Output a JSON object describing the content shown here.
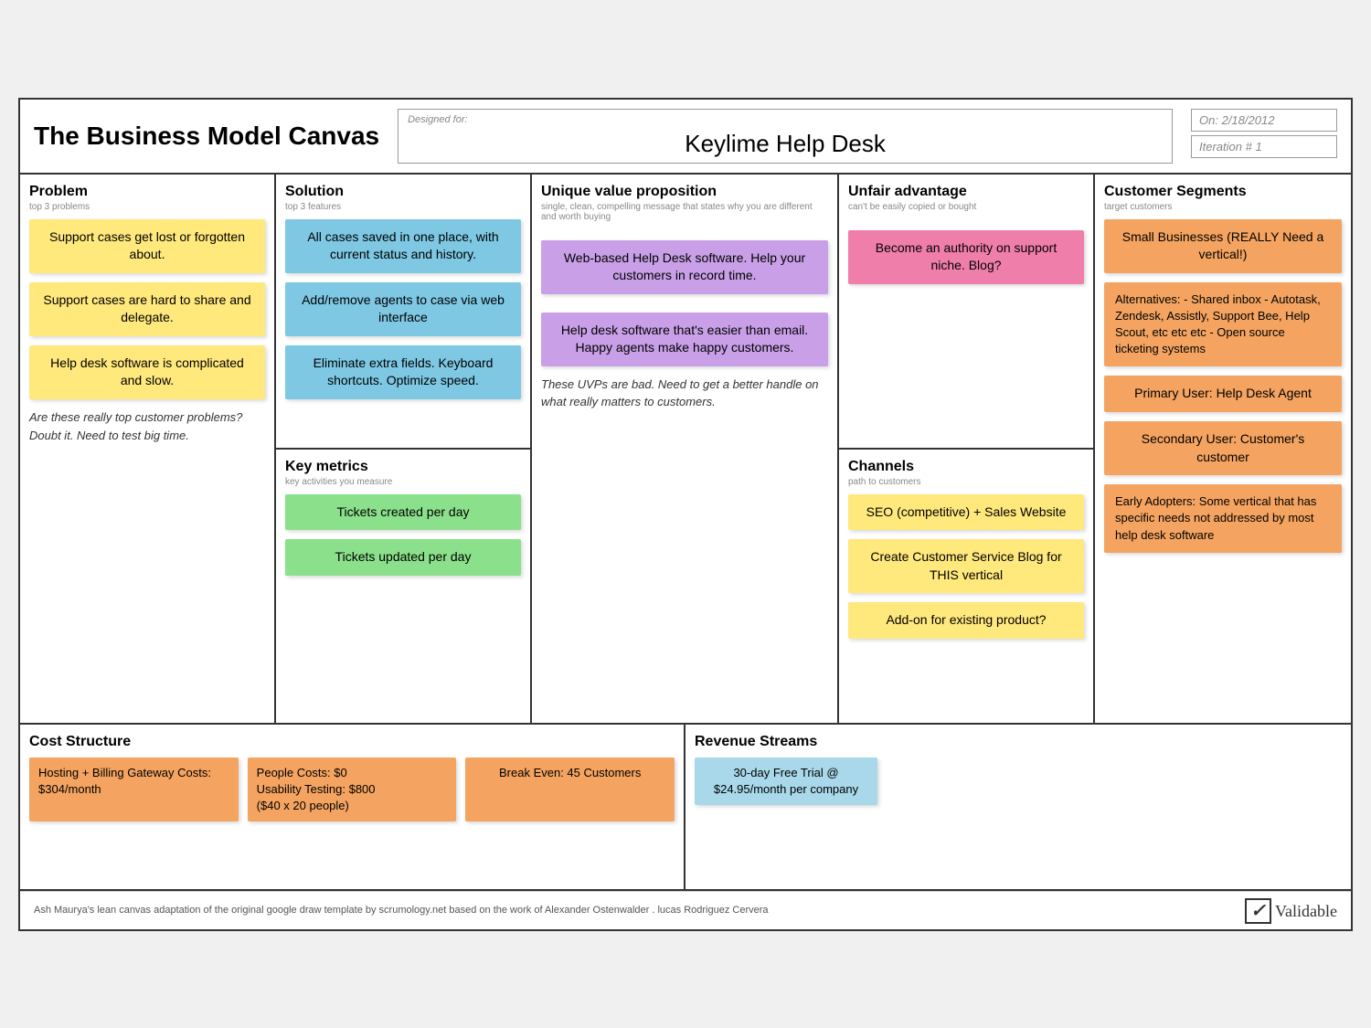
{
  "header": {
    "title": "The Business Model Canvas",
    "designed_for_label": "Designed for:",
    "company_name": "Keylime Help Desk",
    "on_label": "On:",
    "on_date": "2/18/2012",
    "iteration_label": "Iteration #",
    "iteration_number": "1"
  },
  "columns": {
    "problem": {
      "title": "Problem",
      "subtitle": "top 3 problems",
      "stickies": [
        "Support cases get lost or forgotten about.",
        "Support cases are hard to share and delegate.",
        "Help desk software is complicated and slow."
      ],
      "note": "Are these really top customer problems? Doubt it.  Need to test big time."
    },
    "solution": {
      "title": "Solution",
      "subtitle": "top 3 features",
      "stickies": [
        "All cases saved in one place, with current status and history.",
        "Add/remove agents to case via web interface",
        "Eliminate extra fields. Keyboard shortcuts. Optimize speed."
      ],
      "key_metrics_title": "Key metrics",
      "key_metrics_subtitle": "key activities you measure",
      "metrics_stickies": [
        "Tickets created per day",
        "Tickets updated per day"
      ]
    },
    "uvp": {
      "title": "Unique value proposition",
      "subtitle": "single, clean, compelling message that states why you are different and worth buying",
      "stickies": [
        "Web-based Help Desk software. Help your customers in record time.",
        "Help desk software that's easier than email. Happy agents make happy customers."
      ],
      "note": "These UVPs are bad. Need to get a better handle on what really matters to customers."
    },
    "unfair": {
      "title": "Unfair advantage",
      "subtitle": "can't be easily copied or bought",
      "stickies": [
        "Become an authority on support niche. Blog?"
      ],
      "channels_title": "Channels",
      "channels_subtitle": "path to customers",
      "channels_stickies": [
        "SEO (competitive) + Sales Website",
        "Create Customer Service Blog for THIS vertical",
        "Add-on for existing product?"
      ]
    },
    "segments": {
      "title": "Customer Segments",
      "subtitle": "target customers",
      "stickies": [
        "Small Businesses (REALLY Need a vertical!)",
        "Alternatives:\n- Shared inbox\n- Autotask, Zendesk, Assistly, Support Bee, Help Scout, etc etc etc\n- Open source ticketing systems",
        "Primary User: Help Desk Agent",
        "Secondary User: Customer's customer",
        "Early Adopters: Some vertical that has specific needs not addressed by most help desk software"
      ]
    }
  },
  "bottom": {
    "cost": {
      "title": "Cost Structure",
      "stickies": [
        {
          "text": "Hosting + Billing Gateway Costs: $304/month",
          "color": "orange"
        },
        {
          "text": "People Costs: $0\nUsability Testing: $800\n($40 x 20 people)",
          "color": "orange"
        },
        {
          "text": "Break Even: 45 Customers",
          "color": "orange"
        }
      ]
    },
    "revenue": {
      "title": "Revenue Streams",
      "stickies": [
        {
          "text": "30-day Free Trial @ $24.95/month per company",
          "color": "lightblue"
        }
      ]
    }
  },
  "footer": {
    "text": "Ash Maurya's lean canvas adaptation of the original google draw template by scrumology.net based on the work of Alexander Ostenwalder . lucas Rodriguez Cervera",
    "logo": "Validable"
  }
}
